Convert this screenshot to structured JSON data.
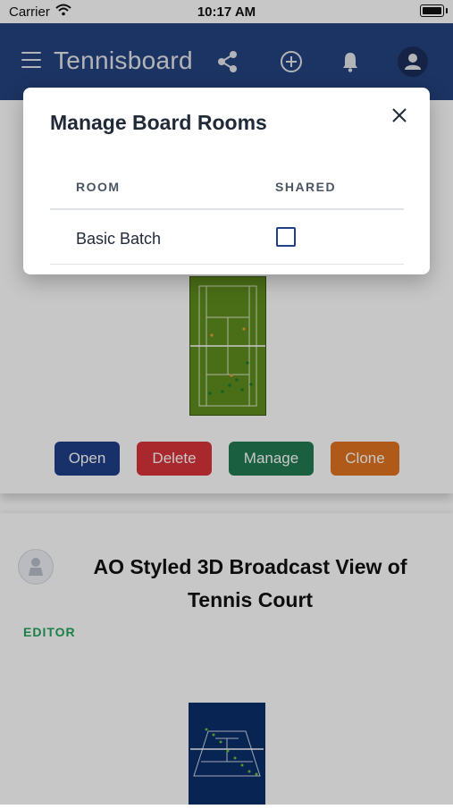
{
  "status_bar": {
    "carrier": "Carrier",
    "time": "10:17 AM"
  },
  "app_bar": {
    "title": "Tennisboard",
    "icons": [
      "menu-icon",
      "share-icon",
      "add-icon",
      "bell-icon",
      "user-avatar-icon"
    ]
  },
  "cards": {
    "first": {
      "buttons": {
        "open": "Open",
        "delete": "Delete",
        "manage": "Manage",
        "clone": "Clone"
      },
      "colors": {
        "open": "#1f3f88",
        "delete": "#d9343a",
        "manage": "#227a52",
        "clone": "#e07421"
      }
    },
    "second": {
      "title": "AO Styled 3D Broadcast View of Tennis Court",
      "role": "EDITOR"
    }
  },
  "modal": {
    "title": "Manage Board Rooms",
    "columns": {
      "room": "ROOM",
      "shared": "SHARED"
    },
    "rows": [
      {
        "room": "Basic Batch",
        "shared": false
      }
    ]
  },
  "colors": {
    "app_bar": "#25437f",
    "editor_badge": "#22a55b"
  }
}
